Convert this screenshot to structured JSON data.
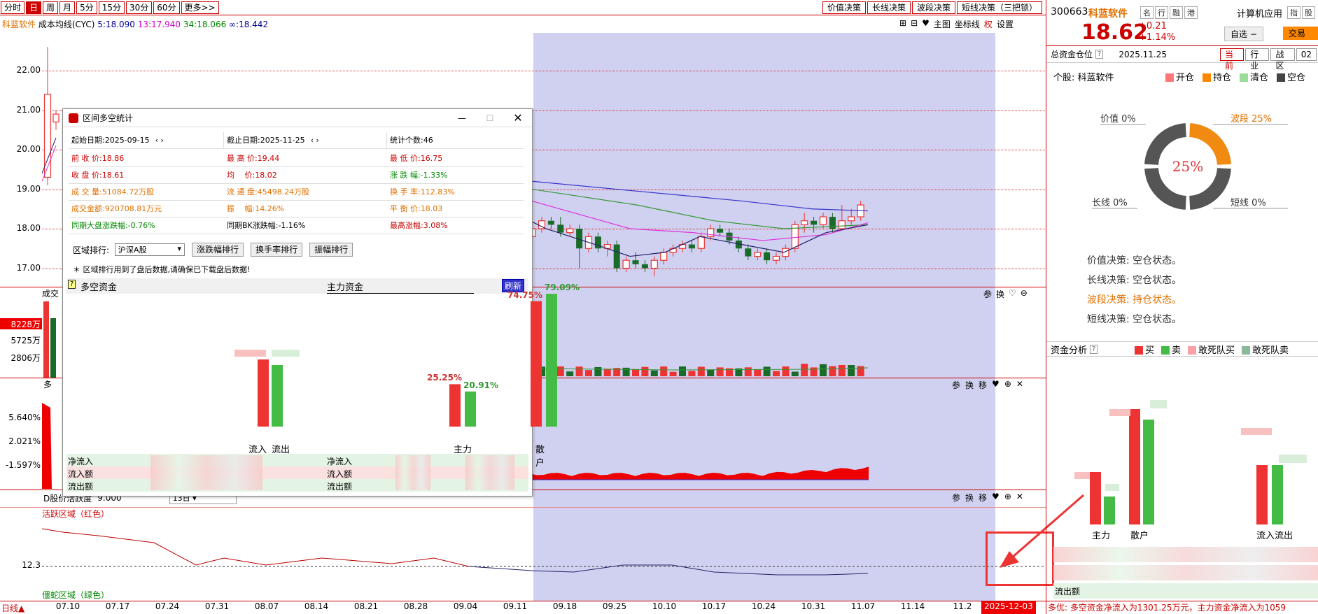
{
  "toolbar": {
    "periods": [
      "分时",
      "日",
      "周",
      "月",
      "5分",
      "15分",
      "30分",
      "60分",
      "更多>>"
    ],
    "active_period": "日",
    "decisions": [
      "价值决策",
      "长线决策",
      "波段决策",
      "短线决策（三把锁）"
    ]
  },
  "chart_header": {
    "stock_name": "科蓝软件",
    "indicator": "成本均线(CYC)",
    "cyc5": "5:18.090",
    "cyc13": "13:17.940",
    "cyc34": "34:18.066",
    "cycinf": "∞:18.442",
    "tools": [
      "主图",
      "坐标线",
      "权",
      "设置"
    ]
  },
  "price_axis": [
    "22.00",
    "21.00",
    "20.00",
    "19.00",
    "18.00",
    "17.00"
  ],
  "vol_panel": {
    "label": "成交",
    "ticks": [
      "8228万",
      "5725万",
      "2806万"
    ],
    "icons": [
      "参",
      "换"
    ]
  },
  "fund_panel": {
    "label": "多",
    "ticks": [
      "5.640%",
      "2.021%",
      "-1.597%"
    ],
    "icons": [
      "参",
      "换",
      "移"
    ]
  },
  "bottom_panel": {
    "indicator": "D股价活跃度",
    "value": "9.000",
    "select": "13日",
    "active_zone": "活跃区域（红色）",
    "dormant_zone": "僵蛇区域（绿色）",
    "level": "12.3",
    "icons": [
      "参",
      "换",
      "移"
    ]
  },
  "x_axis": {
    "prefix": "日线▲",
    "dates": [
      "07.10",
      "07.17",
      "07.24",
      "07.31",
      "08.07",
      "08.14",
      "08.21",
      "08.28",
      "09.04",
      "09.11",
      "09.18",
      "09.25",
      "10.10",
      "10.17",
      "10.24",
      "10.31",
      "11.07",
      "11.14",
      "11.2"
    ],
    "current_date": "2025-12-03"
  },
  "dialog": {
    "title": "区间多空统计",
    "start_date": "起始日期:2025-09-15",
    "end_date": "截止日期:2025-11-25",
    "stat_count": "统计个数:46",
    "rows": [
      [
        "前 收 价:18.86",
        "最 高 价:19.44",
        "最 低 价:16.75"
      ],
      [
        "收 盘 价:18.61",
        "均　 价:18.02",
        "涨 跌 幅:-1.33%"
      ],
      [
        "成 交 量:51084.72万股",
        "流 通 盘:45498.24万股",
        "换 手 率:112.83%"
      ],
      [
        "成交金额:920708.81万元",
        "振　 幅:14.26%",
        "平 衡 价:18.03"
      ],
      [
        "同期大盘涨跌幅:-0.76%",
        "同期BK涨跌幅:-1.16%",
        "最高涨幅:3.08%"
      ]
    ],
    "region_label": "区域排行:",
    "region_select": "沪深A股",
    "rank_buttons": [
      "涨跌幅排行",
      "换手率排行",
      "振幅排行"
    ],
    "note": "＊ 区域排行用到了盘后数据,请确保已下载盘后数据!",
    "section1": "多空资金",
    "section2": "主力资金",
    "refresh": "刷新",
    "bars": {
      "inflow_label": "流入",
      "outflow_label": "流出",
      "main_label": "主力",
      "retail_label": "散户",
      "main_in_pct": "25.25%",
      "main_out_pct": "20.91%",
      "retail_in_pct": "74.75%",
      "retail_out_pct": "79.09%"
    },
    "bottom_labels": [
      "净流入",
      "流入额",
      "流出额"
    ]
  },
  "right_panel": {
    "code": "300663",
    "name": "科蓝软件",
    "tags": [
      "名",
      "行",
      "融",
      "港"
    ],
    "industry": "计算机应用",
    "industry_tags": [
      "指",
      "股"
    ],
    "price": "18.62",
    "change": "+0.21",
    "change_pct": "+1.14%",
    "watch_btn": "自选 −",
    "trade_btn": "交易",
    "position_title": "总资金仓位",
    "position_date": "2025.11.25",
    "position_tabs": [
      "当前",
      "行业",
      "战区",
      "02"
    ],
    "stock_label": "个股: 科蓝软件",
    "position_legend": [
      "开仓",
      "持仓",
      "清仓",
      "空仓"
    ],
    "donut_center": "25%",
    "donut_labels": {
      "value": "价值 0%",
      "wave": "波段 25%",
      "long": "长线 0%",
      "short": "短线 0%"
    },
    "decisions": [
      {
        "text": "价值决策: 空仓状态。",
        "highlight": false
      },
      {
        "text": "长线决策: 空仓状态。",
        "highlight": false
      },
      {
        "text": "波段决策: 持仓状态。",
        "highlight": true
      },
      {
        "text": "短线决策: 空仓状态。",
        "highlight": false
      }
    ],
    "fund_title": "资金分析",
    "fund_legend": [
      "买",
      "卖",
      "敢死队买",
      "敢死队卖"
    ],
    "fund_labels": [
      "主力",
      "散户",
      "流入流出"
    ],
    "outflow_label": "流出额",
    "status_text": "多优: 多空资金净流入为1301.25万元，主力资金净流入为1059"
  },
  "colors": {
    "accent": "#cc0000",
    "highlight_band": "#d0d0f0",
    "up": "#ee2233",
    "down": "#2a9a3a"
  }
}
